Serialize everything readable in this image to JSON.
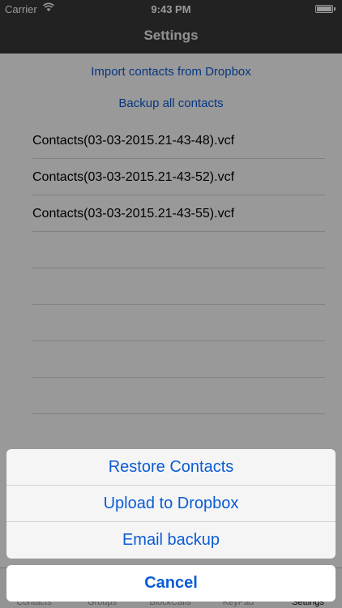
{
  "status_bar": {
    "carrier": "Carrier",
    "time": "9:43 PM",
    "battery_level": 1.0
  },
  "nav_bar": {
    "title": "Settings"
  },
  "actions": {
    "import_label": "Import contacts from Dropbox",
    "backup_label": "Backup all contacts"
  },
  "files": [
    "Contacts(03-03-2015.21-43-48).vcf",
    "Contacts(03-03-2015.21-43-52).vcf",
    "Contacts(03-03-2015.21-43-55).vcf"
  ],
  "tab_bar": {
    "items": [
      "Contacts",
      "Groups",
      "BlockCalls",
      "KeyPad",
      "Settings"
    ],
    "active": "Settings"
  },
  "action_sheet": {
    "options": [
      "Restore Contacts",
      "Upload to Dropbox",
      "Email backup"
    ],
    "cancel_label": "Cancel"
  },
  "colors": {
    "accent": "#0b5cd5",
    "nav_background": "#3a3a3a",
    "overlay": "rgba(0,0,0,0.4)"
  }
}
